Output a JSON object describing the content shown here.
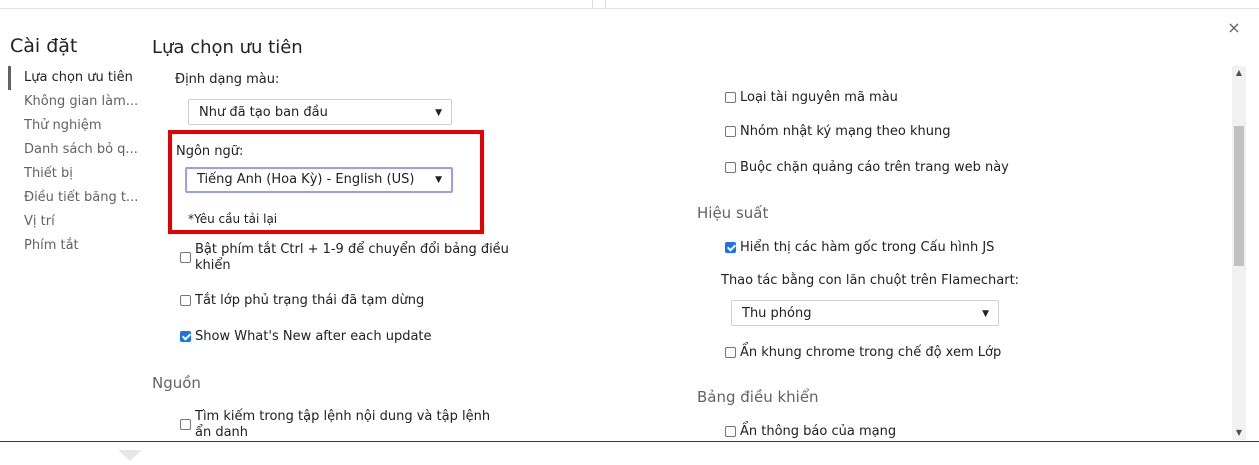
{
  "header": {
    "settings_title": "Cài đặt",
    "page_title": "Lựa chọn ưu tiên",
    "close_glyph": "×"
  },
  "sidebar": {
    "items": [
      {
        "label": "Lựa chọn ưu tiên",
        "active": true
      },
      {
        "label": "Không gian làm..."
      },
      {
        "label": "Thử nghiệm"
      },
      {
        "label": "Danh sách bỏ q..."
      },
      {
        "label": "Thiết bị"
      },
      {
        "label": "Điều tiết băng t..."
      },
      {
        "label": "Vị trí"
      },
      {
        "label": "Phím tắt"
      }
    ]
  },
  "left": {
    "color_format": {
      "label": "Định dạng màu:",
      "value": "Như đã tạo ban đầu"
    },
    "language": {
      "label": "Ngôn ngữ:",
      "value": "Tiếng Anh (Hoa Kỳ) - English (US)",
      "hint": "*Yêu cầu tải lại"
    },
    "checkboxes": [
      {
        "label": "Bật phím tắt Ctrl + 1-9 để chuyển đổi bảng điều khiển",
        "checked": false
      },
      {
        "label": "Tắt lớp phủ trạng thái đã tạm dừng",
        "checked": false
      },
      {
        "label": "Show What's New after each update",
        "checked": true
      }
    ],
    "sources": {
      "title": "Nguồn",
      "checkboxes": [
        {
          "label": "Tìm kiếm trong tập lệnh nội dung và tập lệnh ẩn danh",
          "checked": false
        }
      ]
    }
  },
  "right": {
    "top_checkboxes": [
      {
        "label": "Loại tài nguyên mã màu",
        "checked": false
      },
      {
        "label": "Nhóm nhật ký mạng theo khung",
        "checked": false
      },
      {
        "label": "Buộc chặn quảng cáo trên trang web này",
        "checked": false
      }
    ],
    "performance": {
      "title": "Hiệu suất",
      "native_functions": {
        "label": "Hiển thị các hàm gốc trong Cấu hình JS",
        "checked": true
      },
      "flamechart": {
        "label": "Thao tác bằng con lăn chuột trên Flamechart:",
        "value": "Thu phóng"
      },
      "hide_chrome": {
        "label": "Ẩn khung chrome trong chế độ xem Lớp",
        "checked": false
      }
    },
    "console": {
      "title": "Bảng điều khiển",
      "checkboxes": [
        {
          "label": "Ẩn thông báo của mạng",
          "checked": false
        }
      ]
    }
  },
  "glyphs": {
    "dropdown_arrow": "▼",
    "scroll_up": "▲",
    "scroll_down": "▼"
  }
}
